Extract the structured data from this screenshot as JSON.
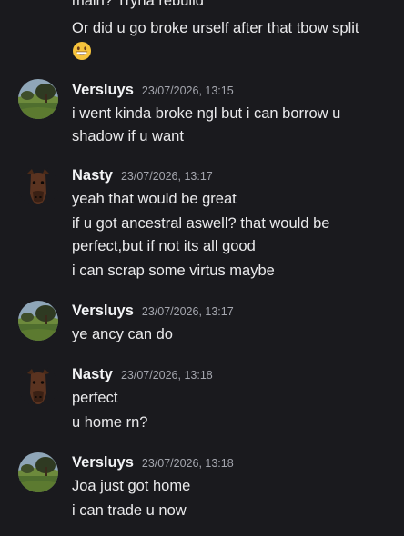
{
  "messages": {
    "carry_line_1": "main? Tryna rebuild",
    "carry_line_2": "Or did u go broke urself after that tbow split",
    "carry_emoji": "grinning-face-emoji",
    "groups": [
      {
        "author": "Versluys",
        "timestamp": "23/07/2026, 13:15",
        "avatar": "landscape-avatar",
        "lines": [
          "i went kinda broke ngl but i can borrow u",
          "shadow if u want"
        ]
      },
      {
        "author": "Nasty",
        "timestamp": "23/07/2026, 13:17",
        "avatar": "horse-head-avatar",
        "lines": [
          "yeah that would be great",
          "if u got ancestral aswell? that would be",
          "perfect,but if not its all good",
          "i can scrap some virtus maybe"
        ]
      },
      {
        "author": "Versluys",
        "timestamp": "23/07/2026, 13:17",
        "avatar": "landscape-avatar",
        "lines": [
          "ye ancy can do"
        ]
      },
      {
        "author": "Nasty",
        "timestamp": "23/07/2026, 13:18",
        "avatar": "horse-head-avatar",
        "lines": [
          "perfect",
          "u home rn?"
        ]
      },
      {
        "author": "Versluys",
        "timestamp": "23/07/2026, 13:18",
        "avatar": "landscape-avatar",
        "lines": [
          "Joa just got home",
          "i can trade u now"
        ]
      }
    ]
  },
  "colors": {
    "background": "#1a1a1e",
    "author": "#f2f3f5",
    "timestamp": "#a4a6ae",
    "message_text": "#eaeaec"
  }
}
